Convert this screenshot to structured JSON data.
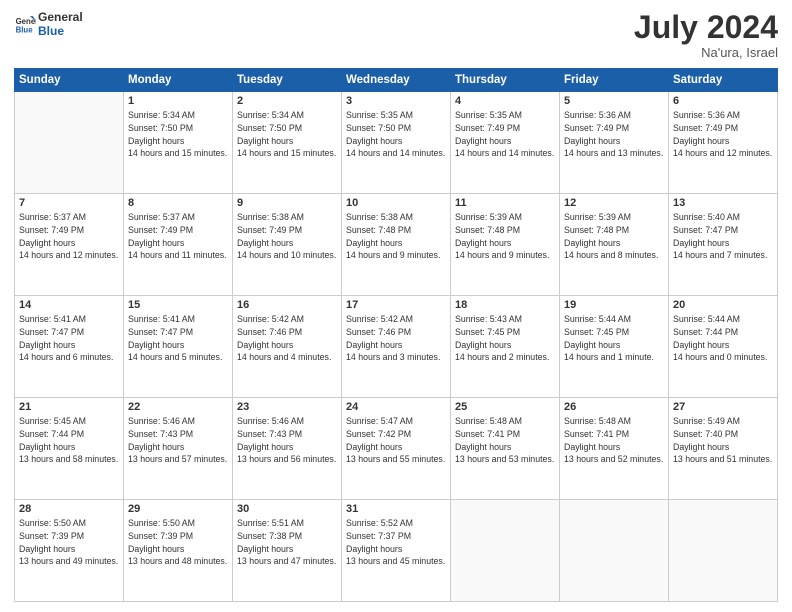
{
  "logo": {
    "line1": "General",
    "line2": "Blue"
  },
  "title": "July 2024",
  "subtitle": "Na'ura, Israel",
  "header": {
    "days": [
      "Sunday",
      "Monday",
      "Tuesday",
      "Wednesday",
      "Thursday",
      "Friday",
      "Saturday"
    ]
  },
  "weeks": [
    {
      "cells": [
        {
          "day": null
        },
        {
          "day": "1",
          "sunrise": "5:34 AM",
          "sunset": "7:50 PM",
          "daylight": "14 hours and 15 minutes."
        },
        {
          "day": "2",
          "sunrise": "5:34 AM",
          "sunset": "7:50 PM",
          "daylight": "14 hours and 15 minutes."
        },
        {
          "day": "3",
          "sunrise": "5:35 AM",
          "sunset": "7:50 PM",
          "daylight": "14 hours and 14 minutes."
        },
        {
          "day": "4",
          "sunrise": "5:35 AM",
          "sunset": "7:49 PM",
          "daylight": "14 hours and 14 minutes."
        },
        {
          "day": "5",
          "sunrise": "5:36 AM",
          "sunset": "7:49 PM",
          "daylight": "14 hours and 13 minutes."
        },
        {
          "day": "6",
          "sunrise": "5:36 AM",
          "sunset": "7:49 PM",
          "daylight": "14 hours and 12 minutes."
        }
      ]
    },
    {
      "cells": [
        {
          "day": "7",
          "sunrise": "5:37 AM",
          "sunset": "7:49 PM",
          "daylight": "14 hours and 12 minutes."
        },
        {
          "day": "8",
          "sunrise": "5:37 AM",
          "sunset": "7:49 PM",
          "daylight": "14 hours and 11 minutes."
        },
        {
          "day": "9",
          "sunrise": "5:38 AM",
          "sunset": "7:49 PM",
          "daylight": "14 hours and 10 minutes."
        },
        {
          "day": "10",
          "sunrise": "5:38 AM",
          "sunset": "7:48 PM",
          "daylight": "14 hours and 9 minutes."
        },
        {
          "day": "11",
          "sunrise": "5:39 AM",
          "sunset": "7:48 PM",
          "daylight": "14 hours and 9 minutes."
        },
        {
          "day": "12",
          "sunrise": "5:39 AM",
          "sunset": "7:48 PM",
          "daylight": "14 hours and 8 minutes."
        },
        {
          "day": "13",
          "sunrise": "5:40 AM",
          "sunset": "7:47 PM",
          "daylight": "14 hours and 7 minutes."
        }
      ]
    },
    {
      "cells": [
        {
          "day": "14",
          "sunrise": "5:41 AM",
          "sunset": "7:47 PM",
          "daylight": "14 hours and 6 minutes."
        },
        {
          "day": "15",
          "sunrise": "5:41 AM",
          "sunset": "7:47 PM",
          "daylight": "14 hours and 5 minutes."
        },
        {
          "day": "16",
          "sunrise": "5:42 AM",
          "sunset": "7:46 PM",
          "daylight": "14 hours and 4 minutes."
        },
        {
          "day": "17",
          "sunrise": "5:42 AM",
          "sunset": "7:46 PM",
          "daylight": "14 hours and 3 minutes."
        },
        {
          "day": "18",
          "sunrise": "5:43 AM",
          "sunset": "7:45 PM",
          "daylight": "14 hours and 2 minutes."
        },
        {
          "day": "19",
          "sunrise": "5:44 AM",
          "sunset": "7:45 PM",
          "daylight": "14 hours and 1 minute."
        },
        {
          "day": "20",
          "sunrise": "5:44 AM",
          "sunset": "7:44 PM",
          "daylight": "14 hours and 0 minutes."
        }
      ]
    },
    {
      "cells": [
        {
          "day": "21",
          "sunrise": "5:45 AM",
          "sunset": "7:44 PM",
          "daylight": "13 hours and 58 minutes."
        },
        {
          "day": "22",
          "sunrise": "5:46 AM",
          "sunset": "7:43 PM",
          "daylight": "13 hours and 57 minutes."
        },
        {
          "day": "23",
          "sunrise": "5:46 AM",
          "sunset": "7:43 PM",
          "daylight": "13 hours and 56 minutes."
        },
        {
          "day": "24",
          "sunrise": "5:47 AM",
          "sunset": "7:42 PM",
          "daylight": "13 hours and 55 minutes."
        },
        {
          "day": "25",
          "sunrise": "5:48 AM",
          "sunset": "7:41 PM",
          "daylight": "13 hours and 53 minutes."
        },
        {
          "day": "26",
          "sunrise": "5:48 AM",
          "sunset": "7:41 PM",
          "daylight": "13 hours and 52 minutes."
        },
        {
          "day": "27",
          "sunrise": "5:49 AM",
          "sunset": "7:40 PM",
          "daylight": "13 hours and 51 minutes."
        }
      ]
    },
    {
      "cells": [
        {
          "day": "28",
          "sunrise": "5:50 AM",
          "sunset": "7:39 PM",
          "daylight": "13 hours and 49 minutes."
        },
        {
          "day": "29",
          "sunrise": "5:50 AM",
          "sunset": "7:39 PM",
          "daylight": "13 hours and 48 minutes."
        },
        {
          "day": "30",
          "sunrise": "5:51 AM",
          "sunset": "7:38 PM",
          "daylight": "13 hours and 47 minutes."
        },
        {
          "day": "31",
          "sunrise": "5:52 AM",
          "sunset": "7:37 PM",
          "daylight": "13 hours and 45 minutes."
        },
        {
          "day": null
        },
        {
          "day": null
        },
        {
          "day": null
        }
      ]
    }
  ],
  "labels": {
    "sunrise": "Sunrise:",
    "sunset": "Sunset:",
    "daylight": "Daylight hours"
  }
}
